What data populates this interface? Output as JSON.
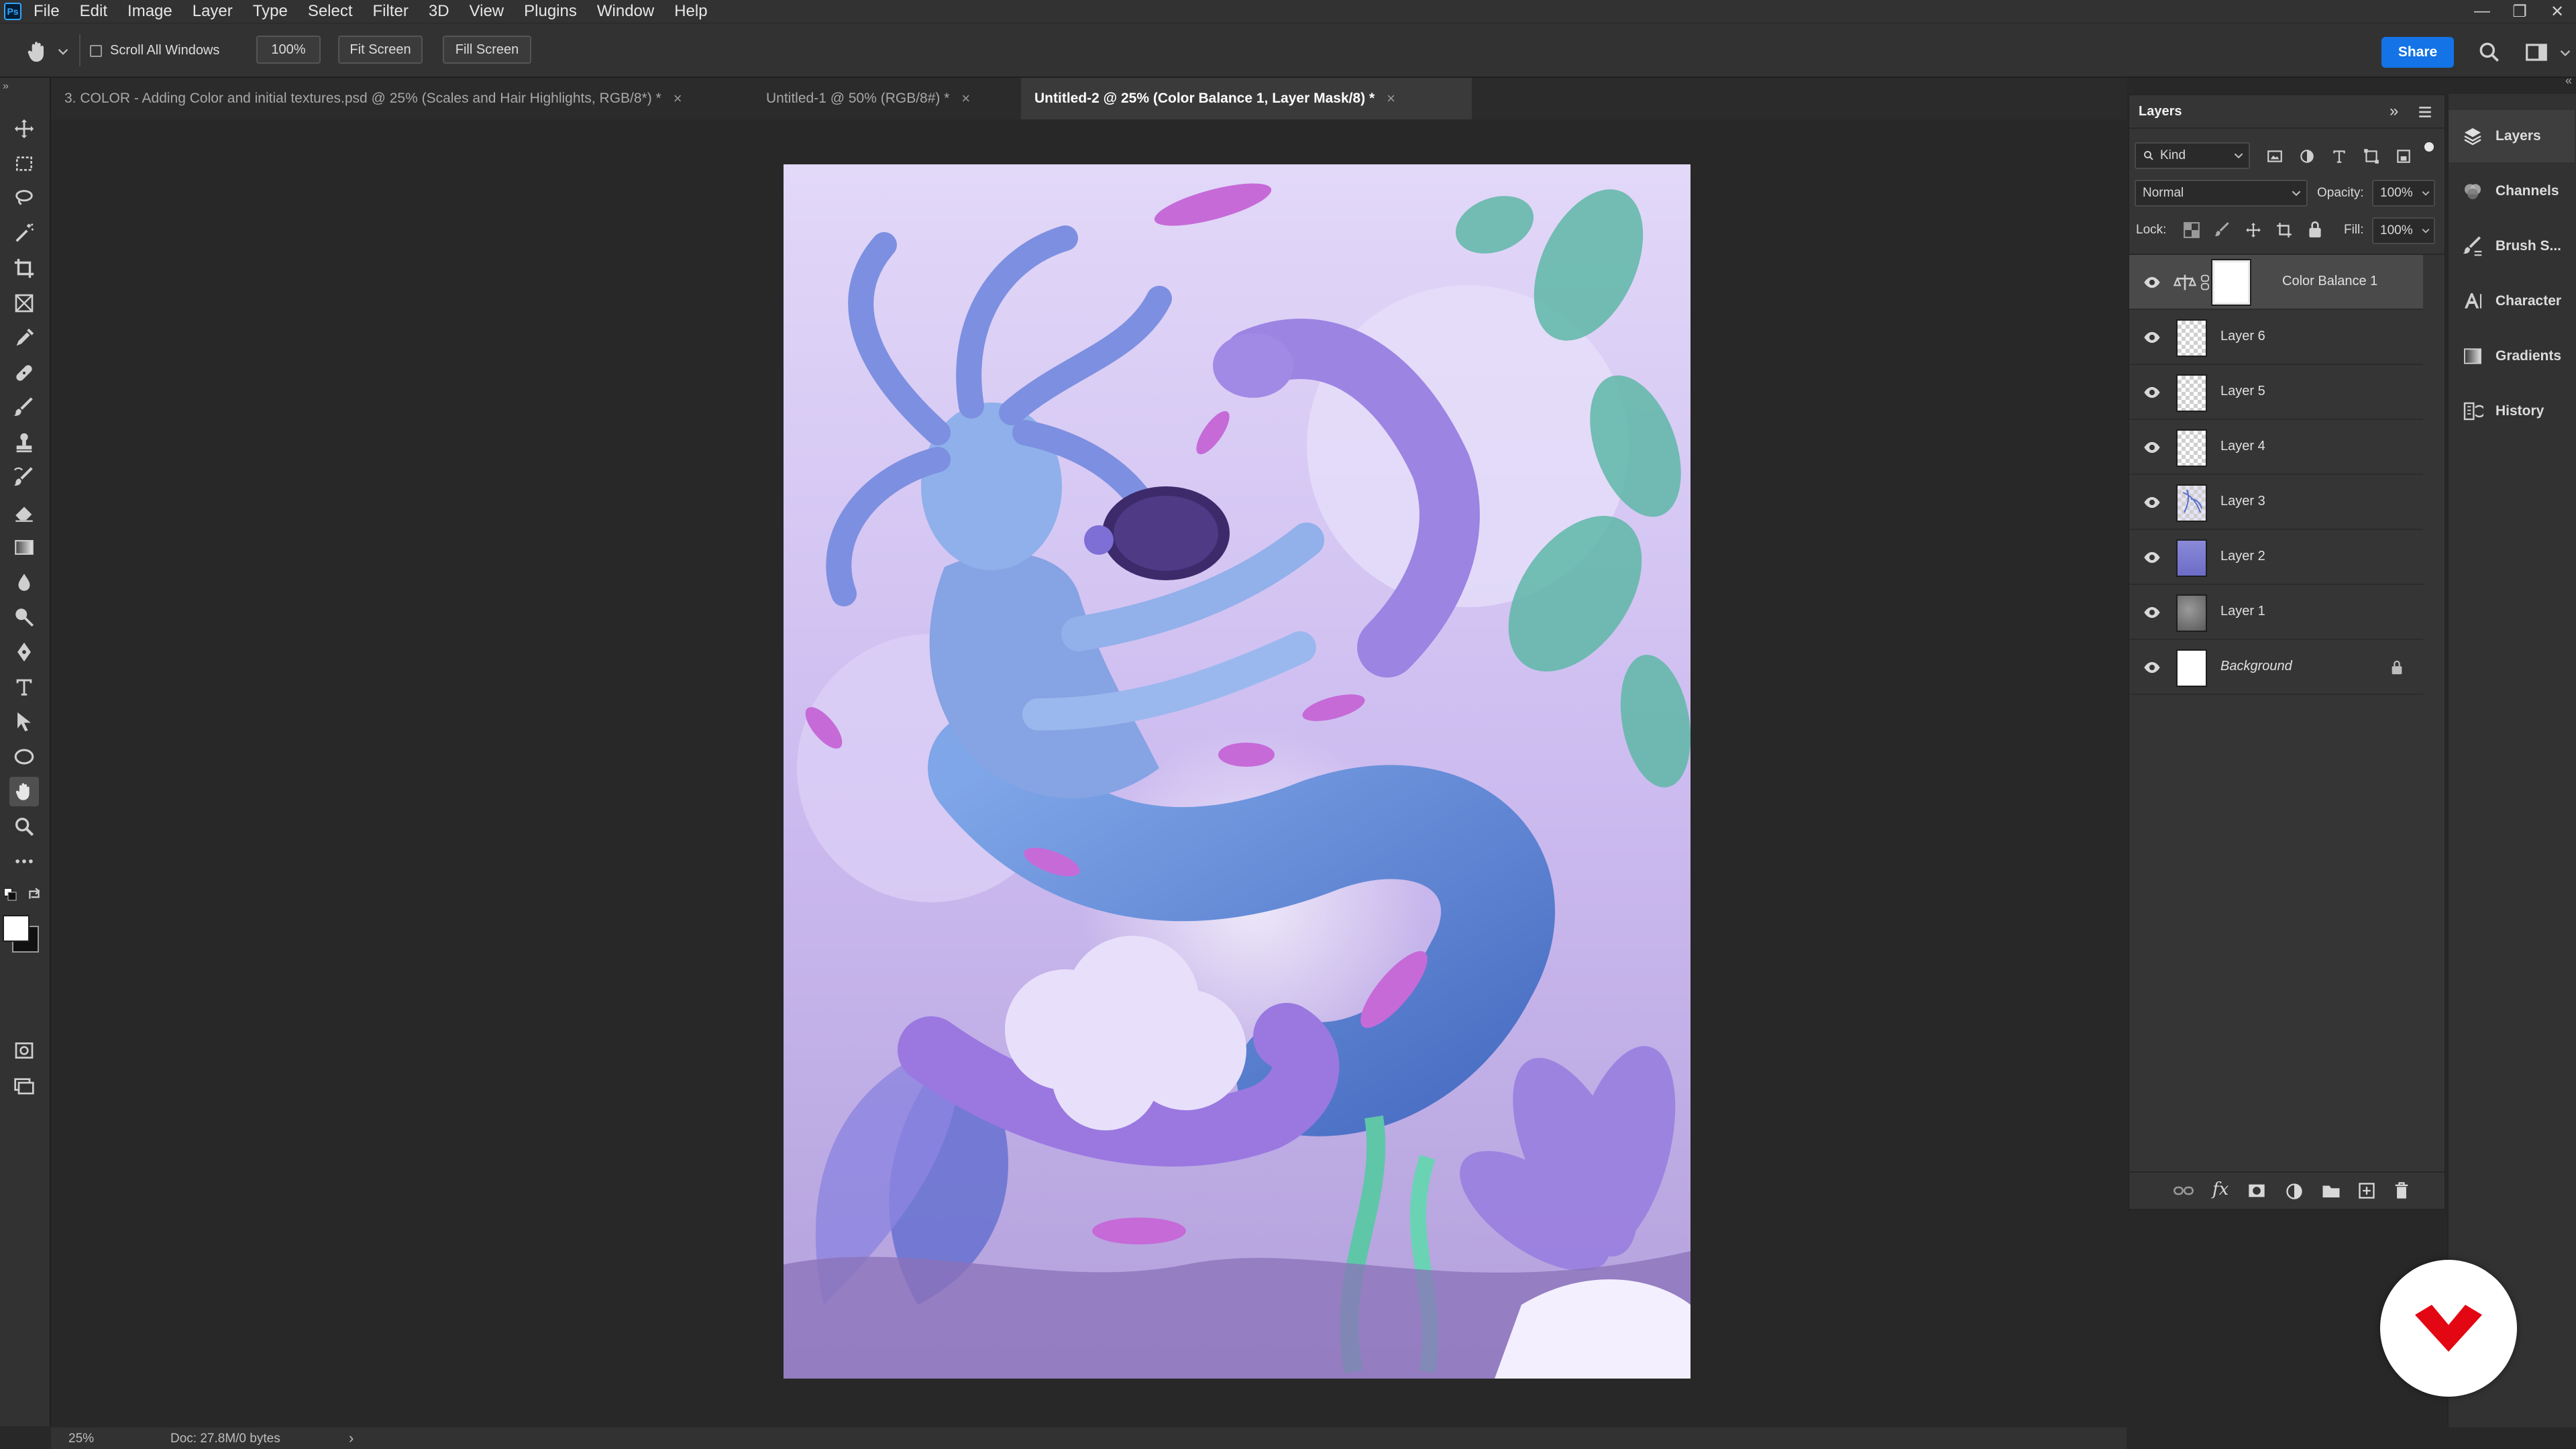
{
  "app": {
    "logo": "Ps"
  },
  "menu": [
    "File",
    "Edit",
    "Image",
    "Layer",
    "Type",
    "Select",
    "Filter",
    "3D",
    "View",
    "Plugins",
    "Window",
    "Help"
  ],
  "options": {
    "scroll_all_windows": "Scroll All Windows",
    "zoom_value": "100%",
    "fit_screen": "Fit Screen",
    "fill_screen": "Fill Screen",
    "share": "Share"
  },
  "tabs": [
    {
      "label": "3. COLOR - Adding Color and initial textures.psd @ 25% (Scales and Hair Highlights, RGB/8*) *",
      "active": false
    },
    {
      "label": "Untitled-1 @ 50% (RGB/8#) *",
      "active": false
    },
    {
      "label": "Untitled-2 @ 25% (Color Balance 1, Layer Mask/8) *",
      "active": true
    }
  ],
  "layers_panel": {
    "title": "Layers",
    "filter_kind": "Kind",
    "blend_mode": "Normal",
    "opacity_label": "Opacity:",
    "opacity_value": "100%",
    "lock_label": "Lock:",
    "fill_label": "Fill:",
    "fill_value": "100%",
    "layers": [
      {
        "name": "Color Balance 1",
        "type": "adjustment",
        "active": true
      },
      {
        "name": "Layer 6",
        "type": "transparent"
      },
      {
        "name": "Layer 5",
        "type": "transparent"
      },
      {
        "name": "Layer 4",
        "type": "transparent"
      },
      {
        "name": "Layer 3",
        "type": "sketch"
      },
      {
        "name": "Layer 2",
        "type": "color"
      },
      {
        "name": "Layer 1",
        "type": "image"
      },
      {
        "name": "Background",
        "type": "background",
        "locked": true
      }
    ]
  },
  "dock": [
    "Layers",
    "Channels",
    "Brush S...",
    "Character",
    "Gradients",
    "History"
  ],
  "status": {
    "zoom": "25%",
    "doc": "Doc: 27.8M/0 bytes",
    "arrow": "›"
  },
  "colors": {
    "accent": "#1473e6",
    "watermark": "#e30613"
  }
}
